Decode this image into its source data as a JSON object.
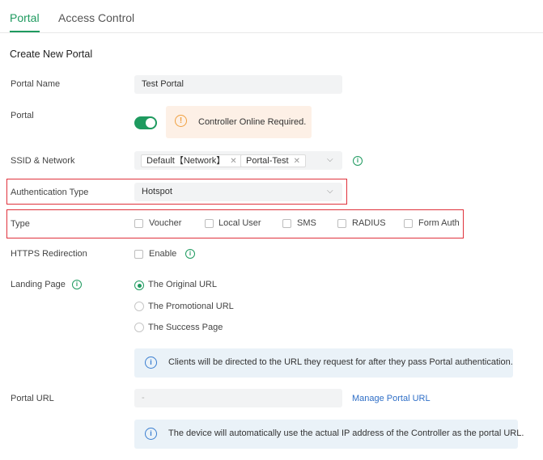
{
  "tabs": [
    {
      "label": "Portal",
      "active": true
    },
    {
      "label": "Access Control",
      "active": false
    }
  ],
  "section_title": "Create New Portal",
  "portal_name": {
    "label": "Portal Name",
    "value": "Test Portal"
  },
  "portal": {
    "label": "Portal",
    "enabled": true,
    "warning_text": "Controller Online Required."
  },
  "ssid": {
    "label": "SSID & Network",
    "chips": [
      "Default【Network】",
      "Portal-Test"
    ]
  },
  "auth_type": {
    "label": "Authentication Type",
    "value": "Hotspot"
  },
  "type": {
    "label": "Type",
    "options": [
      "Voucher",
      "Local User",
      "SMS",
      "RADIUS",
      "Form Auth"
    ]
  },
  "https_redirection": {
    "label": "HTTPS Redirection",
    "option": "Enable"
  },
  "landing_page": {
    "label": "Landing Page",
    "options": [
      "The Original URL",
      "The Promotional URL",
      "The Success Page"
    ],
    "selected": 0,
    "info_text": "Clients will be directed to the URL they request for after they pass Portal authentication."
  },
  "portal_url": {
    "label": "Portal URL",
    "value": "-",
    "link": "Manage Portal URL",
    "info_text": "The device will automatically use the actual IP address of the Controller as the portal URL."
  },
  "colors": {
    "accent": "#1e9a5f",
    "warning": "#f0a040",
    "highlight": "#e0323c",
    "link": "#2f6fc7"
  }
}
